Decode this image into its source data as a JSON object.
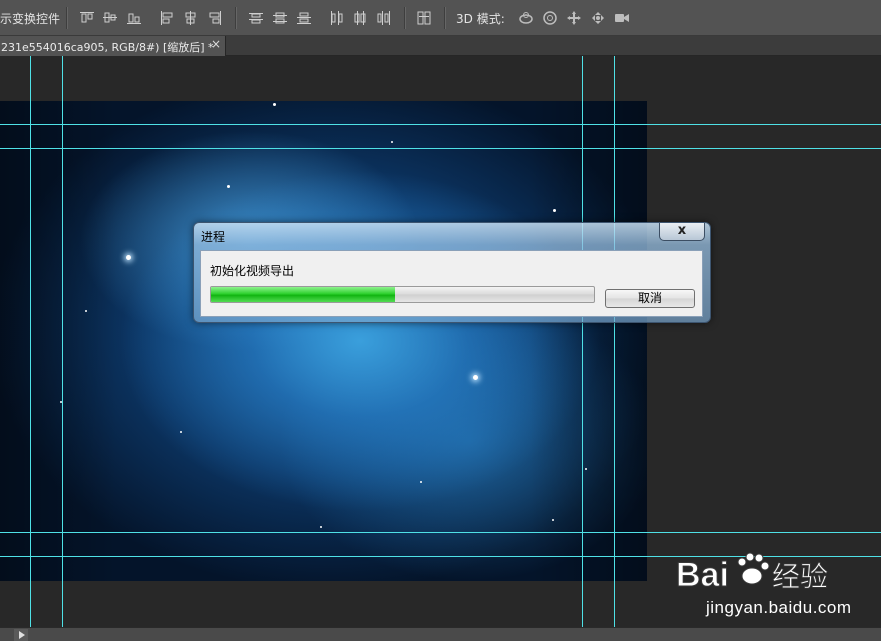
{
  "options_bar": {
    "transform_controls_label": "示变换控件",
    "mode_3d_label": "3D 模式:",
    "align_icons": [
      "align-top-edges-icon",
      "align-vertical-centers-icon",
      "align-bottom-edges-icon",
      "align-left-edges-icon",
      "align-horizontal-centers-icon",
      "align-right-edges-icon"
    ],
    "distribute_icons": [
      "distribute-top-icon",
      "distribute-vcenter-icon",
      "distribute-bottom-icon",
      "distribute-left-icon",
      "distribute-hcenter-icon",
      "distribute-right-icon"
    ],
    "auto_align_icon": "auto-align-layers-icon",
    "mode_3d_icons": [
      "rotate-3d-icon",
      "roll-3d-icon",
      "drag-3d-icon",
      "slide-3d-icon",
      "scale-3d-icon"
    ]
  },
  "document_tab": {
    "title": "231e554016ca905, RGB/8#) [缩放后] *",
    "close_glyph": "×"
  },
  "dialog": {
    "title": "进程",
    "close_glyph": "x",
    "message": "初始化视频导出",
    "progress": 0.48,
    "cancel_label": "取消"
  },
  "watermark": {
    "brand": "Bai 经验",
    "url": "jingyan.baidu.com"
  },
  "colors": {
    "guide": "#4fe1e6",
    "progress_green": "#22c922",
    "panel_bg": "#535353",
    "workspace_bg": "#282828"
  }
}
